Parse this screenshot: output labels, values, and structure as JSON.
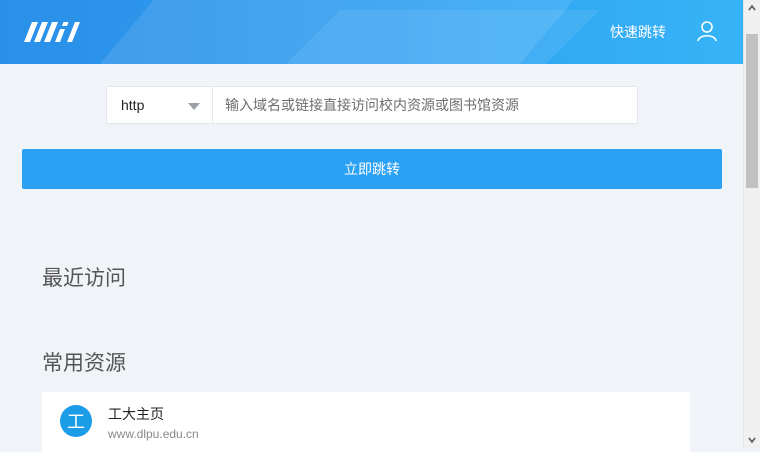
{
  "header": {
    "logo_text": "MiII",
    "jump_link": "快速跳转",
    "colors": {
      "start": "#2a8fe8",
      "end": "#36b4f7"
    }
  },
  "url_bar": {
    "protocol": "http",
    "placeholder": "输入域名或链接直接访问校内资源或图书馆资源"
  },
  "go_button": {
    "label": "立即跳转",
    "color": "#2aa1f5"
  },
  "recent": {
    "title": "最近访问"
  },
  "common": {
    "title": "常用资源",
    "items": [
      {
        "icon_char": "工",
        "name": "工大主页",
        "url": "www.dlpu.edu.cn"
      }
    ]
  }
}
